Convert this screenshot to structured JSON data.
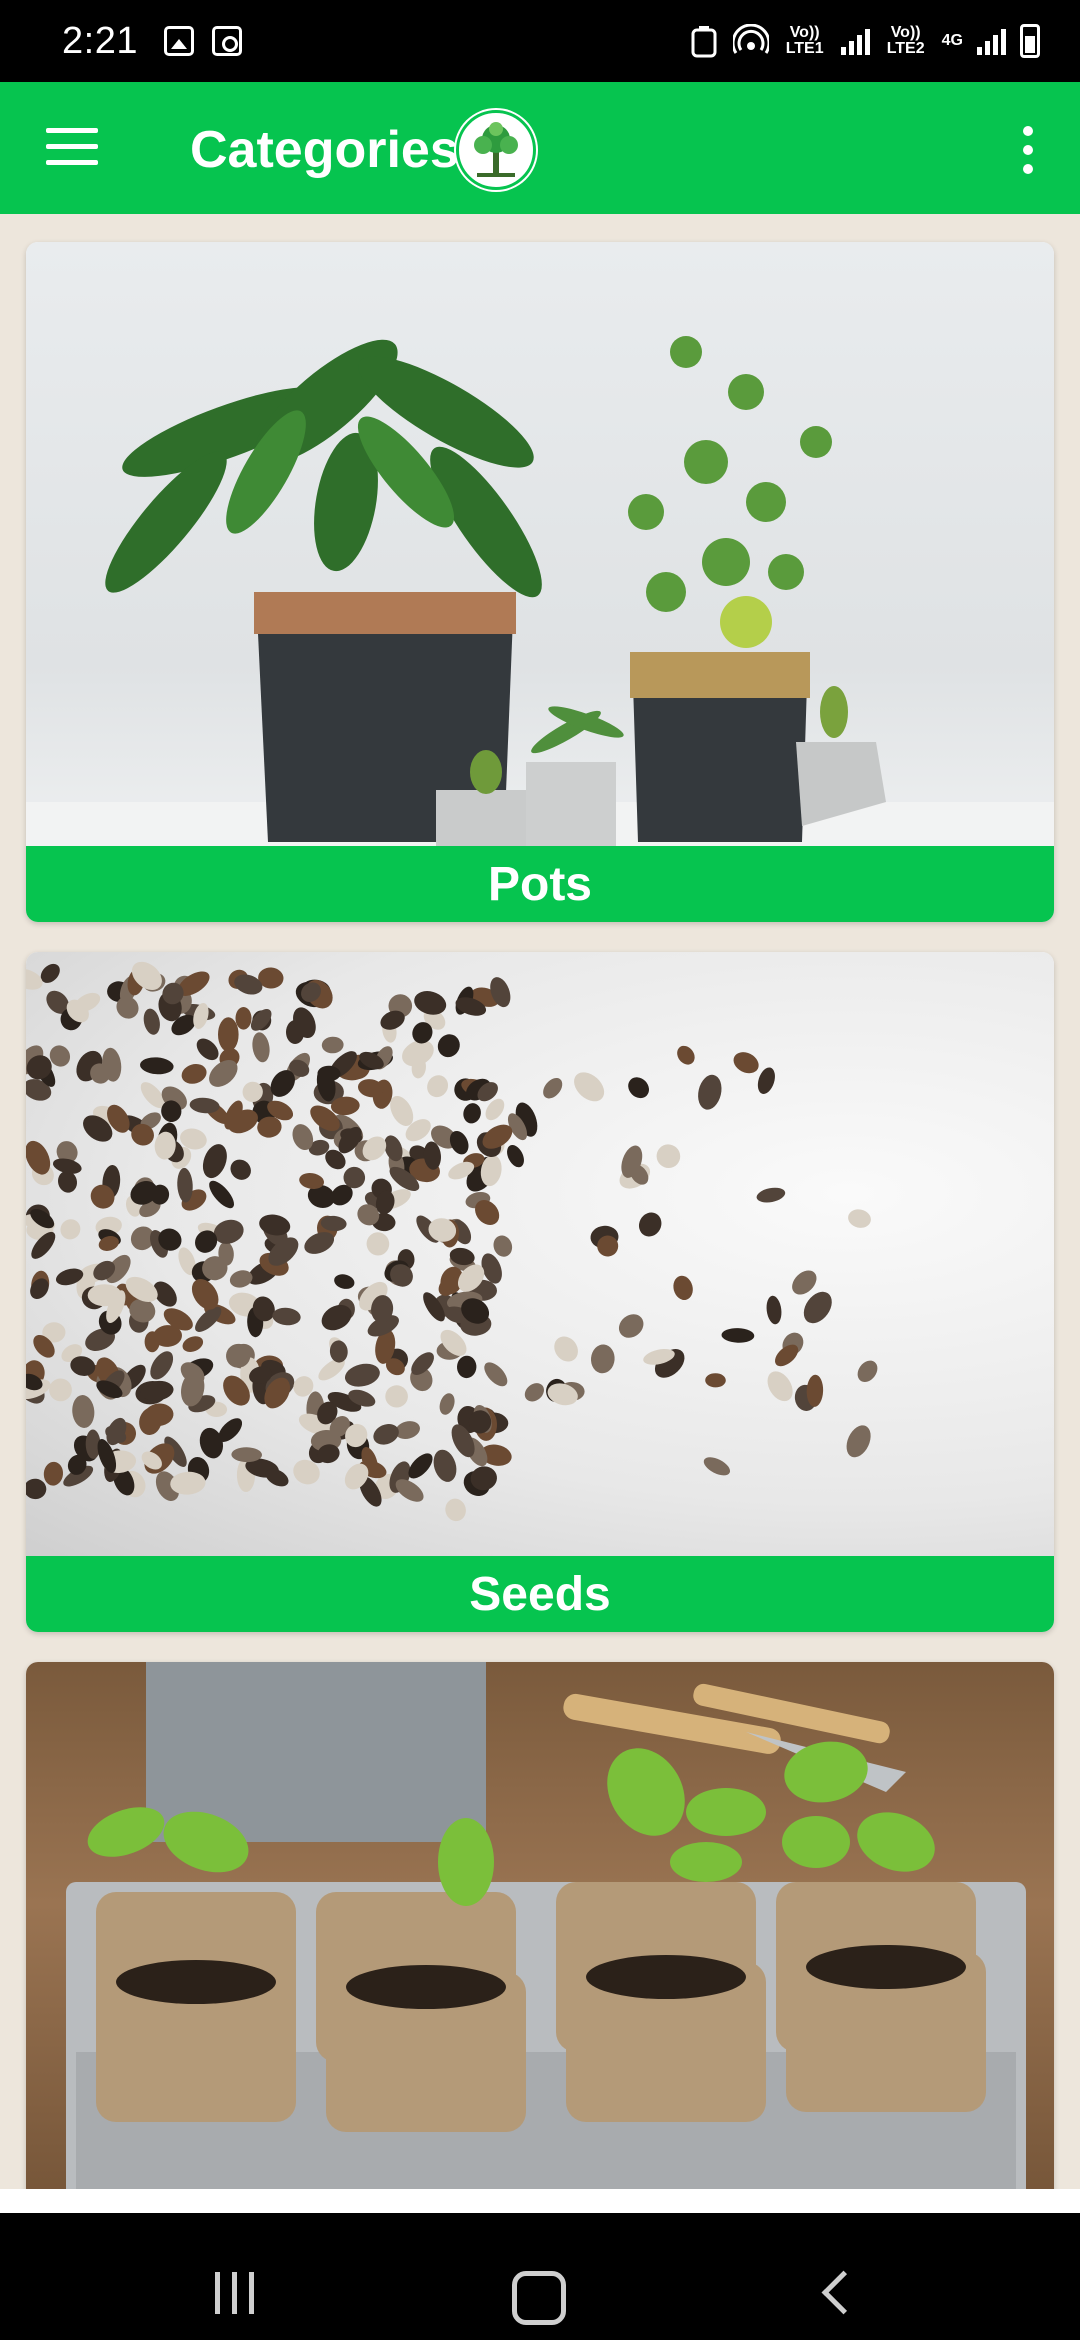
{
  "status_bar": {
    "time": "2:21",
    "left_icons": [
      "gallery-icon",
      "clock-notification-icon"
    ],
    "sim1_label": "Vo)) LTE1",
    "sim2_label": "Vo)) LTE2",
    "network_type": "4G"
  },
  "app_bar": {
    "title": "Categories",
    "menu_icon": "hamburger-menu-icon",
    "overflow_icon": "more-vertical-icon"
  },
  "categories": [
    {
      "label": "Pots",
      "image": "potted-plants-photo"
    },
    {
      "label": "Seeds",
      "image": "seeds-photo"
    },
    {
      "label": "",
      "image": "seedlings-in-peat-pots-photo"
    }
  ],
  "colors": {
    "primary": "#06c44f",
    "background": "#ede6dc"
  }
}
